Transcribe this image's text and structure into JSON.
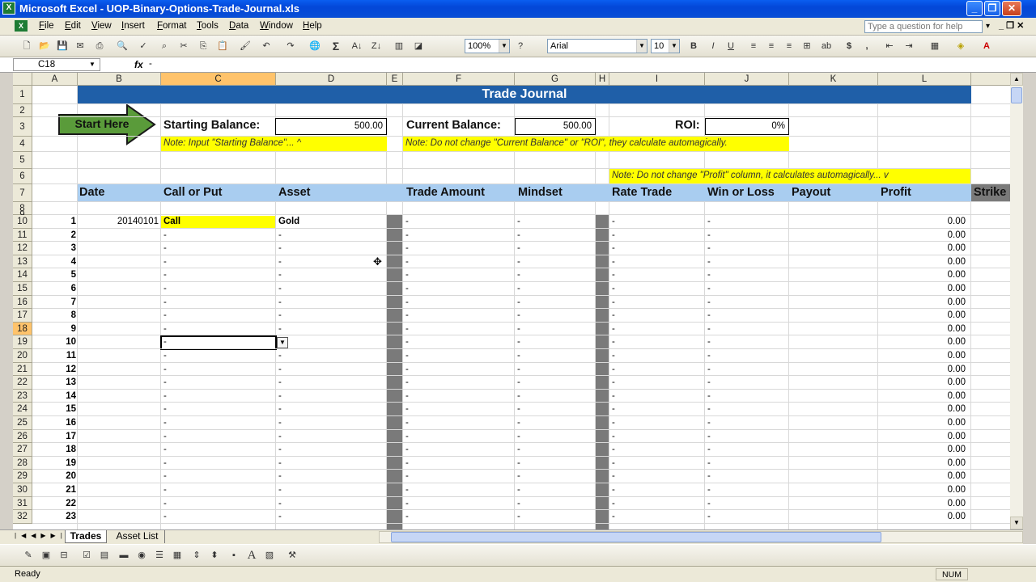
{
  "window": {
    "title": "Microsoft Excel - UOP-Binary-Options-Trade-Journal.xls"
  },
  "menu": [
    "File",
    "Edit",
    "View",
    "Insert",
    "Format",
    "Tools",
    "Data",
    "Window",
    "Help"
  ],
  "help_placeholder": "Type a question for help",
  "toolbar": {
    "zoom": "100%",
    "font": "Arial",
    "size": "10"
  },
  "formula": {
    "namebox": "C18",
    "fx": "fx",
    "value": "-"
  },
  "columns": [
    "A",
    "B",
    "C",
    "D",
    "E",
    "F",
    "G",
    "H",
    "I",
    "J",
    "K",
    "L"
  ],
  "rows": [
    "1",
    "2",
    "3",
    "4",
    "5",
    "6",
    "7",
    "8",
    "9",
    "10",
    "11",
    "12",
    "13",
    "14",
    "15",
    "16",
    "17",
    "18",
    "19",
    "20",
    "21",
    "22",
    "23",
    "24",
    "25",
    "26",
    "27",
    "28",
    "29",
    "30",
    "31",
    "32"
  ],
  "sheet": {
    "title": "Trade Journal",
    "start_here": "Start Here",
    "starting_balance_label": "Starting Balance:",
    "starting_balance": "500.00",
    "current_balance_label": "Current Balance:",
    "current_balance": "500.00",
    "roi_label": "ROI:",
    "roi": "0%",
    "note_starting": "Note: Input \"Starting Balance\"...   ^",
    "note_current": "Note: Do not change \"Current Balance\" or \"ROI\", they calculate automagically.",
    "note_profit": "Note: Do not change \"Profit\" column, it calculates automagically...   v",
    "headers": {
      "date": "Date",
      "call_put": "Call or Put",
      "asset": "Asset",
      "trade_amount": "Trade Amount",
      "mindset": "Mindset",
      "rate_trade": "Rate Trade",
      "win_loss": "Win or Loss",
      "payout": "Payout",
      "profit": "Profit",
      "strike": "Strike"
    },
    "trades": [
      {
        "n": "1",
        "date": "20140101",
        "call_put": "Call",
        "asset": "Gold",
        "profit": "0.00"
      },
      {
        "n": "2",
        "date": "",
        "call_put": "-",
        "asset": "-",
        "profit": "0.00"
      },
      {
        "n": "3",
        "date": "",
        "call_put": "-",
        "asset": "-",
        "profit": "0.00"
      },
      {
        "n": "4",
        "date": "",
        "call_put": "-",
        "asset": "-",
        "profit": "0.00"
      },
      {
        "n": "5",
        "date": "",
        "call_put": "-",
        "asset": "-",
        "profit": "0.00"
      },
      {
        "n": "6",
        "date": "",
        "call_put": "-",
        "asset": "-",
        "profit": "0.00"
      },
      {
        "n": "7",
        "date": "",
        "call_put": "-",
        "asset": "-",
        "profit": "0.00"
      },
      {
        "n": "8",
        "date": "",
        "call_put": "-",
        "asset": "-",
        "profit": "0.00"
      },
      {
        "n": "9",
        "date": "",
        "call_put": "-",
        "asset": "-",
        "profit": "0.00"
      },
      {
        "n": "10",
        "date": "",
        "call_put": "-",
        "asset": "-",
        "profit": "0.00"
      },
      {
        "n": "11",
        "date": "",
        "call_put": "-",
        "asset": "-",
        "profit": "0.00"
      },
      {
        "n": "12",
        "date": "",
        "call_put": "-",
        "asset": "-",
        "profit": "0.00"
      },
      {
        "n": "13",
        "date": "",
        "call_put": "-",
        "asset": "-",
        "profit": "0.00"
      },
      {
        "n": "14",
        "date": "",
        "call_put": "-",
        "asset": "-",
        "profit": "0.00"
      },
      {
        "n": "15",
        "date": "",
        "call_put": "-",
        "asset": "-",
        "profit": "0.00"
      },
      {
        "n": "16",
        "date": "",
        "call_put": "-",
        "asset": "-",
        "profit": "0.00"
      },
      {
        "n": "17",
        "date": "",
        "call_put": "-",
        "asset": "-",
        "profit": "0.00"
      },
      {
        "n": "18",
        "date": "",
        "call_put": "-",
        "asset": "-",
        "profit": "0.00"
      },
      {
        "n": "19",
        "date": "",
        "call_put": "-",
        "asset": "-",
        "profit": "0.00"
      },
      {
        "n": "20",
        "date": "",
        "call_put": "-",
        "asset": "-",
        "profit": "0.00"
      },
      {
        "n": "21",
        "date": "",
        "call_put": "-",
        "asset": "-",
        "profit": "0.00"
      },
      {
        "n": "22",
        "date": "",
        "call_put": "-",
        "asset": "-",
        "profit": "0.00"
      },
      {
        "n": "23",
        "date": "",
        "call_put": "-",
        "asset": "-",
        "profit": "0.00"
      }
    ],
    "dash": "-"
  },
  "tabs": [
    "Trades",
    "Asset List"
  ],
  "status": {
    "left": "Ready",
    "num": "NUM"
  },
  "colors": {
    "title_band": "#1f5fa8",
    "header_band": "#a9cdf0",
    "note_yellow": "#ffff00",
    "arrow_green": "#5a9b3a",
    "gray_col": "#7a7a7a",
    "active_header": "#ffc36b"
  }
}
